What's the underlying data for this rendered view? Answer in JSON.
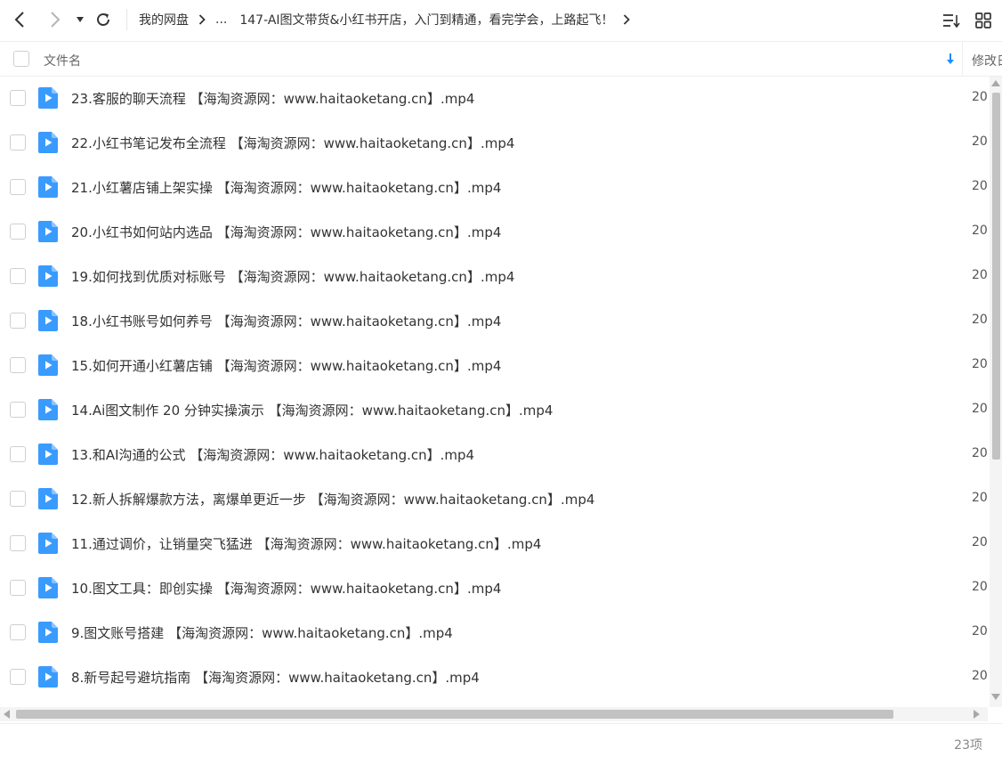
{
  "nav": {
    "breadcrumb": {
      "root": "我的网盘",
      "ellipsis": "...",
      "current": "147-AI图文带货&小红书开店，入门到精通，看完学会，上路起飞！"
    }
  },
  "header": {
    "name_label": "文件名",
    "modified_label": "修改日"
  },
  "files": [
    {
      "name": "23.客服的聊天流程 【海淘资源网：www.haitaoketang.cn】.mp4",
      "date": "20"
    },
    {
      "name": "22.小红书笔记发布全流程 【海淘资源网：www.haitaoketang.cn】.mp4",
      "date": "20"
    },
    {
      "name": "21.小红薯店铺上架实操 【海淘资源网：www.haitaoketang.cn】.mp4",
      "date": "20"
    },
    {
      "name": "20.小红书如何站内选品 【海淘资源网：www.haitaoketang.cn】.mp4",
      "date": "20"
    },
    {
      "name": "19.如何找到优质对标账号 【海淘资源网：www.haitaoketang.cn】.mp4",
      "date": "20"
    },
    {
      "name": "18.小红书账号如何养号 【海淘资源网：www.haitaoketang.cn】.mp4",
      "date": "20"
    },
    {
      "name": "15.如何开通小红薯店铺 【海淘资源网：www.haitaoketang.cn】.mp4",
      "date": "20"
    },
    {
      "name": "14.Ai图文制作 20 分钟实操演示 【海淘资源网：www.haitaoketang.cn】.mp4",
      "date": "20"
    },
    {
      "name": "13.和AI沟通的公式 【海淘资源网：www.haitaoketang.cn】.mp4",
      "date": "20"
    },
    {
      "name": "12.新人拆解爆款方法，离爆单更近一步 【海淘资源网：www.haitaoketang.cn】.mp4",
      "date": "20"
    },
    {
      "name": "11.通过调价，让销量突飞猛进 【海淘资源网：www.haitaoketang.cn】.mp4",
      "date": "20"
    },
    {
      "name": "10.图文工具：即创实操 【海淘资源网：www.haitaoketang.cn】.mp4",
      "date": "20"
    },
    {
      "name": "9.图文账号搭建 【海淘资源网：www.haitaoketang.cn】.mp4",
      "date": "20"
    },
    {
      "name": "8.新号起号避坑指南 【海淘资源网：www.haitaoketang.cn】.mp4",
      "date": "20"
    }
  ],
  "status": {
    "item_count": "23项"
  },
  "colors": {
    "accent": "#1a8cff",
    "file_icon": "#3a9bff"
  },
  "icons": {
    "back": "chevron-left-icon",
    "forward": "chevron-right-icon",
    "history": "caret-down-icon",
    "refresh": "refresh-icon",
    "sort": "sort-list-icon",
    "grid": "grid-view-icon",
    "file": "video-file-icon"
  }
}
